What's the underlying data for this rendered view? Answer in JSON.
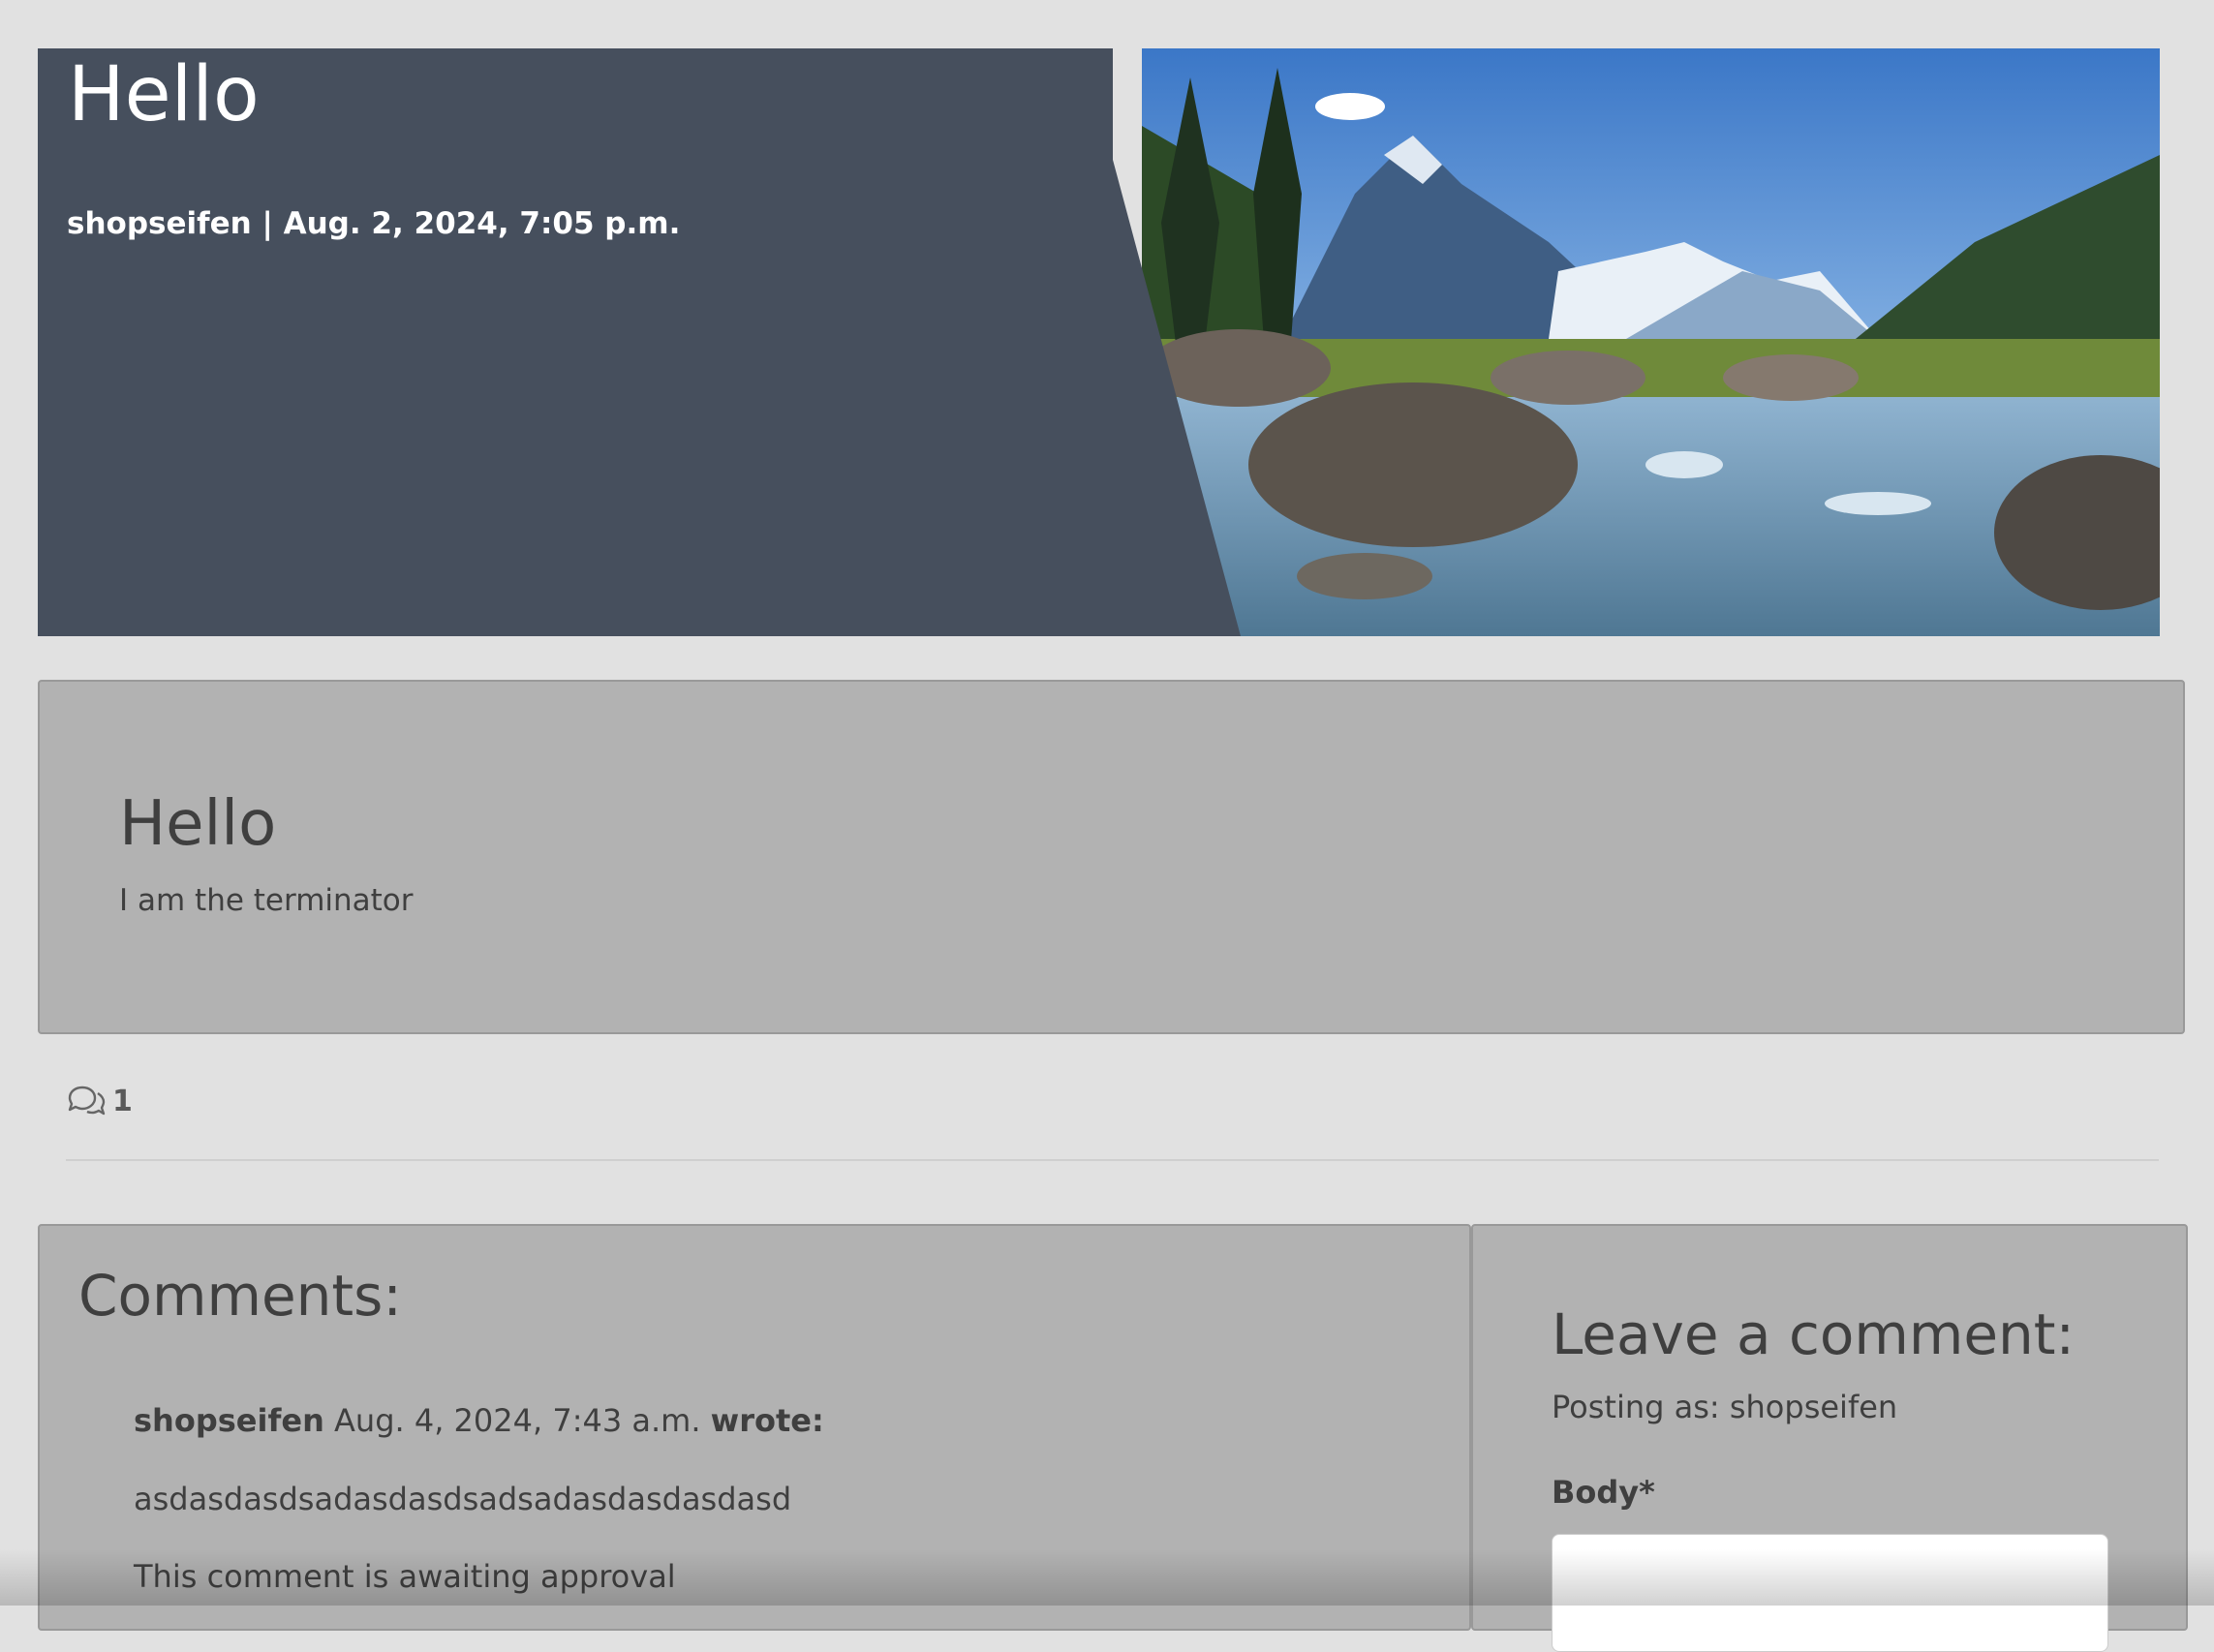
{
  "hero": {
    "title": "Hello",
    "meta": "shopseifen | Aug. 2, 2024, 7:05 p.m.",
    "image_icon": "landscape-photo"
  },
  "post": {
    "title": "Hello",
    "body": "I am the terminator"
  },
  "stats": {
    "comment_icon": "comments-icon",
    "comment_count": "1"
  },
  "comments": {
    "heading": "Comments:",
    "items": [
      {
        "author": "shopseifen",
        "date": "Aug. 4, 2024, 7:43 a.m.",
        "wrote": "wrote:",
        "text": "asdasdasdsadasdasdsadsadasdasdasdasd",
        "status": "This comment is awaiting approval"
      }
    ]
  },
  "comment_form": {
    "heading": "Leave a comment:",
    "posting_as": "Posting as: shopseifen",
    "body_label": "Body*",
    "body_value": ""
  },
  "colors": {
    "page_bg": "#e1e1e1",
    "hero_panel": "#464f5d",
    "card_bg": "#b2b2b2"
  }
}
